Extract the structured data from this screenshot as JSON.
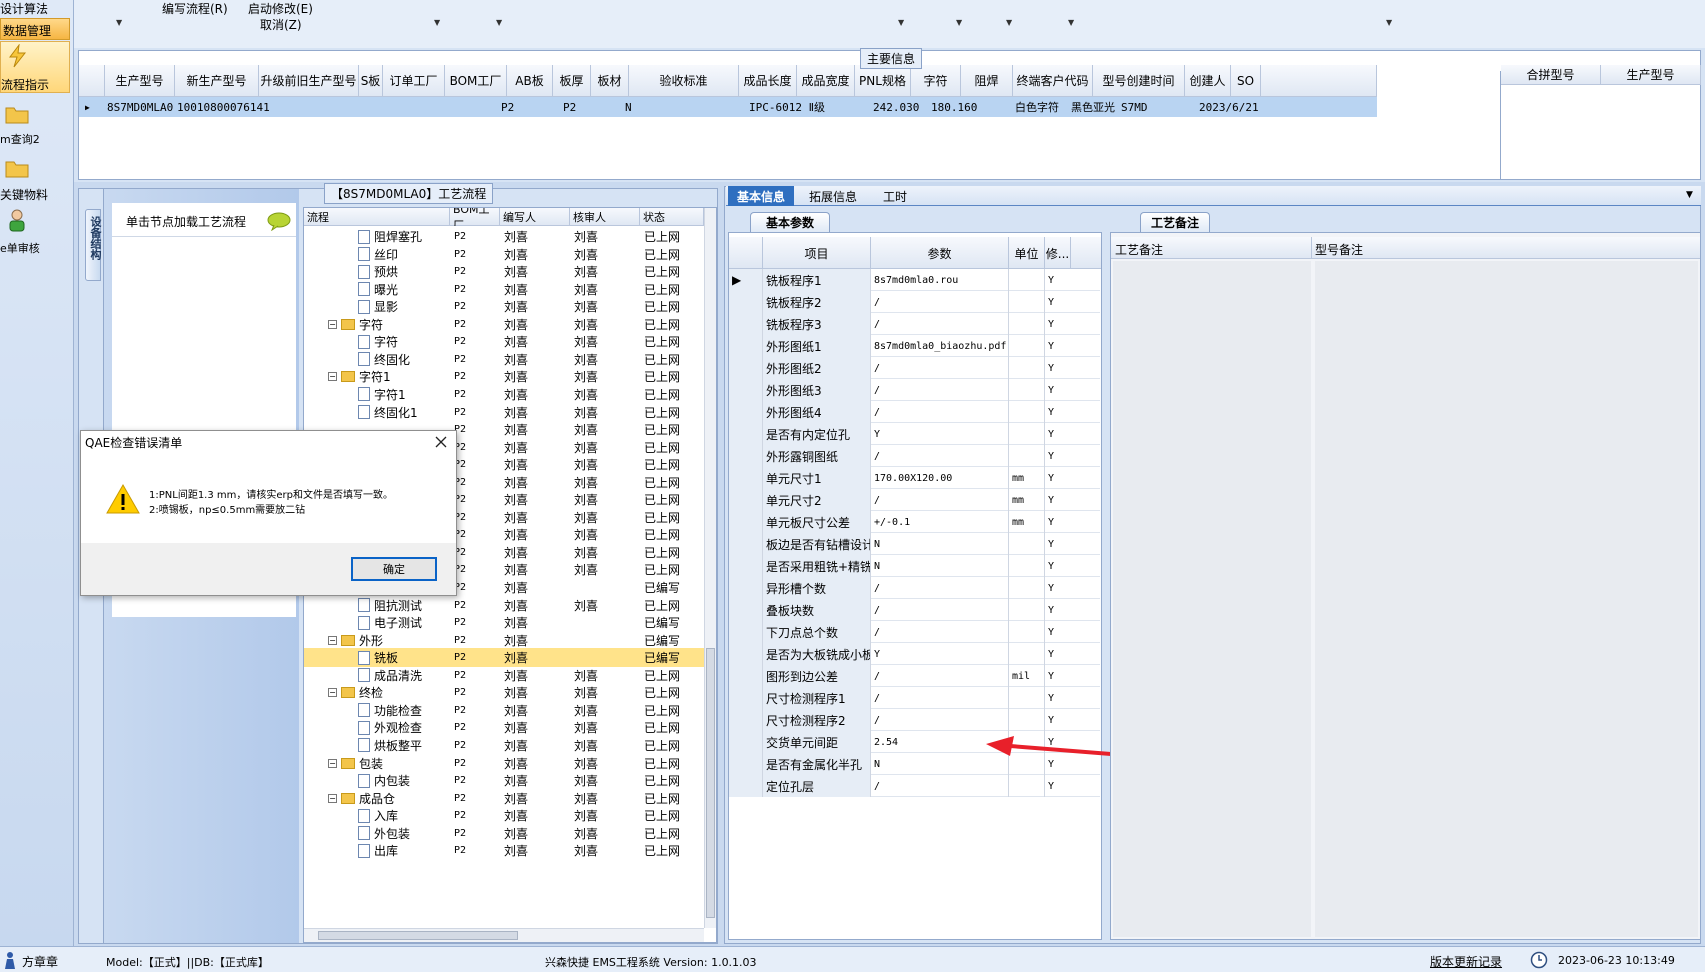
{
  "left_nav": {
    "design_algo": "设计算法",
    "data_mgmt": "数据管理",
    "flow_guide": "流程指示",
    "query2": "m查询2",
    "key_materials": "关键物料",
    "single_review": "e单审核"
  },
  "top_menu": {
    "edit_flow": "编写流程(R)",
    "start_modify": "启动修改(E)",
    "cancel": "取消(Z)"
  },
  "main_info": {
    "title": "主要信息",
    "columns": [
      "生产型号",
      "新生产型号",
      "升级前旧生产型号",
      "S板",
      "订单工厂",
      "BOM工厂",
      "AB板",
      "板厚",
      "板材",
      "验收标准",
      "成品长度",
      "成品宽度",
      "PNL规格",
      "字符",
      "阻焊",
      "终端客户代码",
      "型号创建时间",
      "创建人",
      "SO"
    ],
    "row": {
      "model": "8S7MD0MLA0",
      "new_model": "10010800076141",
      "order_factory": "P2",
      "bom_factory": "P2",
      "ab": "N",
      "standard": "IPC-6012 Ⅱ级",
      "length": "242.030",
      "width": "180.160",
      "char": "白色字符",
      "mask": "黑色亚光",
      "customer": "S7MD",
      "created": "2023/6/21"
    },
    "side_columns": [
      "合拼型号",
      "生产型号"
    ]
  },
  "flow_panel": {
    "title": "【8S7MD0MLA0】工艺流程",
    "vertical_tab": "设备结构",
    "load_hint": "单击节点加载工艺流程",
    "columns": [
      "流程",
      "BOM工厂",
      "编写人",
      "核审人",
      "状态"
    ],
    "rows": [
      {
        "name": "阻焊塞孔",
        "type": "file",
        "f": "P2",
        "w": "刘喜",
        "r": "刘喜",
        "s": "已上网"
      },
      {
        "name": "丝印",
        "type": "file",
        "f": "P2",
        "w": "刘喜",
        "r": "刘喜",
        "s": "已上网"
      },
      {
        "name": "预烘",
        "type": "file",
        "f": "P2",
        "w": "刘喜",
        "r": "刘喜",
        "s": "已上网"
      },
      {
        "name": "曝光",
        "type": "file",
        "f": "P2",
        "w": "刘喜",
        "r": "刘喜",
        "s": "已上网"
      },
      {
        "name": "显影",
        "type": "file",
        "f": "P2",
        "w": "刘喜",
        "r": "刘喜",
        "s": "已上网"
      },
      {
        "name": "字符",
        "type": "dir",
        "f": "P2",
        "w": "刘喜",
        "r": "刘喜",
        "s": "已上网"
      },
      {
        "name": "字符",
        "type": "file",
        "f": "P2",
        "w": "刘喜",
        "r": "刘喜",
        "s": "已上网"
      },
      {
        "name": "终固化",
        "type": "file",
        "f": "P2",
        "w": "刘喜",
        "r": "刘喜",
        "s": "已上网"
      },
      {
        "name": "字符1",
        "type": "dir",
        "f": "P2",
        "w": "刘喜",
        "r": "刘喜",
        "s": "已上网"
      },
      {
        "name": "字符1",
        "type": "file",
        "f": "P2",
        "w": "刘喜",
        "r": "刘喜",
        "s": "已上网"
      },
      {
        "name": "终固化1",
        "type": "file",
        "f": "P2",
        "w": "刘喜",
        "r": "刘喜",
        "s": "已上网"
      },
      {
        "name": "",
        "type": "none",
        "f": "P2",
        "w": "刘喜",
        "r": "刘喜",
        "s": "已上网"
      },
      {
        "name": "",
        "type": "none",
        "f": "P2",
        "w": "刘喜",
        "r": "刘喜",
        "s": "已上网"
      },
      {
        "name": "",
        "type": "none",
        "f": "P2",
        "w": "刘喜",
        "r": "刘喜",
        "s": "已上网"
      },
      {
        "name": "",
        "type": "none",
        "f": "P2",
        "w": "刘喜",
        "r": "刘喜",
        "s": "已上网"
      },
      {
        "name": "",
        "type": "none",
        "f": "P2",
        "w": "刘喜",
        "r": "刘喜",
        "s": "已上网"
      },
      {
        "name": "",
        "type": "none",
        "f": "P2",
        "w": "刘喜",
        "r": "刘喜",
        "s": "已上网"
      },
      {
        "name": "",
        "type": "none",
        "f": "P2",
        "w": "刘喜",
        "r": "刘喜",
        "s": "已上网"
      },
      {
        "name": "",
        "type": "none",
        "f": "P2",
        "w": "刘喜",
        "r": "刘喜",
        "s": "已上网"
      },
      {
        "name": "",
        "type": "none",
        "f": "P2",
        "w": "刘喜",
        "r": "刘喜",
        "s": "已上网"
      },
      {
        "name": "",
        "type": "none",
        "f": "P2",
        "w": "刘喜",
        "r": "",
        "s": "已编写"
      },
      {
        "name": "阻抗测试",
        "type": "file",
        "f": "P2",
        "w": "刘喜",
        "r": "刘喜",
        "s": "已上网"
      },
      {
        "name": "电子测试",
        "type": "file",
        "f": "P2",
        "w": "刘喜",
        "r": "",
        "s": "已编写"
      },
      {
        "name": "外形",
        "type": "dir",
        "f": "P2",
        "w": "刘喜",
        "r": "",
        "s": "已编写"
      },
      {
        "name": "铣板",
        "type": "file",
        "f": "P2",
        "w": "刘喜",
        "r": "",
        "s": "已编写",
        "sel": true
      },
      {
        "name": "成品清洗",
        "type": "file",
        "f": "P2",
        "w": "刘喜",
        "r": "刘喜",
        "s": "已上网"
      },
      {
        "name": "终检",
        "type": "dir",
        "f": "P2",
        "w": "刘喜",
        "r": "刘喜",
        "s": "已上网"
      },
      {
        "name": "功能检查",
        "type": "file",
        "f": "P2",
        "w": "刘喜",
        "r": "刘喜",
        "s": "已上网"
      },
      {
        "name": "外观检查",
        "type": "file",
        "f": "P2",
        "w": "刘喜",
        "r": "刘喜",
        "s": "已上网"
      },
      {
        "name": "烘板整平",
        "type": "file",
        "f": "P2",
        "w": "刘喜",
        "r": "刘喜",
        "s": "已上网"
      },
      {
        "name": "包装",
        "type": "dir",
        "f": "P2",
        "w": "刘喜",
        "r": "刘喜",
        "s": "已上网"
      },
      {
        "name": "内包装",
        "type": "file",
        "f": "P2",
        "w": "刘喜",
        "r": "刘喜",
        "s": "已上网"
      },
      {
        "name": "成品仓",
        "type": "dir",
        "f": "P2",
        "w": "刘喜",
        "r": "刘喜",
        "s": "已上网"
      },
      {
        "name": "入库",
        "type": "file",
        "f": "P2",
        "w": "刘喜",
        "r": "刘喜",
        "s": "已上网"
      },
      {
        "name": "外包装",
        "type": "file",
        "f": "P2",
        "w": "刘喜",
        "r": "刘喜",
        "s": "已上网"
      },
      {
        "name": "出库",
        "type": "file",
        "f": "P2",
        "w": "刘喜",
        "r": "刘喜",
        "s": "已上网"
      }
    ]
  },
  "right_tabs": [
    "基本信息",
    "拓展信息",
    "工时"
  ],
  "basic_params": {
    "subtab": "基本参数",
    "columns": [
      "项目",
      "参数",
      "单位",
      "修..."
    ],
    "rows": [
      {
        "item": "铣板程序1",
        "param": "8s7md0mla0.rou",
        "unit": "",
        "mod": "Y"
      },
      {
        "item": "铣板程序2",
        "param": "/",
        "unit": "",
        "mod": "Y"
      },
      {
        "item": "铣板程序3",
        "param": "/",
        "unit": "",
        "mod": "Y"
      },
      {
        "item": "外形图纸1",
        "param": "8s7md0mla0_biaozhu.pdf",
        "unit": "",
        "mod": "Y"
      },
      {
        "item": "外形图纸2",
        "param": "/",
        "unit": "",
        "mod": "Y"
      },
      {
        "item": "外形图纸3",
        "param": "/",
        "unit": "",
        "mod": "Y"
      },
      {
        "item": "外形图纸4",
        "param": "/",
        "unit": "",
        "mod": "Y"
      },
      {
        "item": "是否有内定位孔",
        "param": "Y",
        "unit": "",
        "mod": "Y"
      },
      {
        "item": "外形露铜图纸",
        "param": "/",
        "unit": "",
        "mod": "Y"
      },
      {
        "item": "单元尺寸1",
        "param": "170.00X120.00",
        "unit": "mm",
        "mod": "Y"
      },
      {
        "item": "单元尺寸2",
        "param": "/",
        "unit": "mm",
        "mod": "Y"
      },
      {
        "item": "单元板尺寸公差",
        "param": "+/-0.1",
        "unit": "mm",
        "mod": "Y"
      },
      {
        "item": "板边是否有钻槽设计",
        "param": "N",
        "unit": "",
        "mod": "Y"
      },
      {
        "item": "是否采用粗铣+精铣",
        "param": "N",
        "unit": "",
        "mod": "Y"
      },
      {
        "item": "异形槽个数",
        "param": "/",
        "unit": "",
        "mod": "Y"
      },
      {
        "item": "叠板块数",
        "param": "/",
        "unit": "",
        "mod": "Y"
      },
      {
        "item": "下刀点总个数",
        "param": "/",
        "unit": "",
        "mod": "Y"
      },
      {
        "item": "是否为大板铣成小板",
        "param": "Y",
        "unit": "",
        "mod": "Y"
      },
      {
        "item": "图形到边公差",
        "param": "/",
        "unit": "mil",
        "mod": "Y"
      },
      {
        "item": "尺寸检测程序1",
        "param": "/",
        "unit": "",
        "mod": "Y"
      },
      {
        "item": "尺寸检测程序2",
        "param": "/",
        "unit": "",
        "mod": "Y"
      },
      {
        "item": "交货单元间距",
        "param": "2.54",
        "unit": "",
        "mod": "Y"
      },
      {
        "item": "是否有金属化半孔",
        "param": "N",
        "unit": "",
        "mod": "Y"
      },
      {
        "item": "定位孔层",
        "param": "/",
        "unit": "",
        "mod": "Y"
      }
    ]
  },
  "remarks": {
    "tab": "工艺备注",
    "col1": "工艺备注",
    "col2": "型号备注"
  },
  "dialog": {
    "title": "QAE检查错误清单",
    "line1": "1:PNL间距1.3 mm，请核实erp和文件是否填写一致。",
    "line2": "2:喷锡板，np≤0.5mm需要放二钻",
    "ok": "确定"
  },
  "status_bar": {
    "user": "方章章",
    "model_db": "Model:【正式】||DB:【正式库】",
    "app": "兴森快捷 EMS工程系统 Version: 1.0.1.03",
    "update_log": "版本更新记录",
    "datetime": "2023-06-23 10:13:49"
  },
  "colors": {
    "accent": "#2f6fc0",
    "selection": "#b9d4f2",
    "highlight": "#ffe38a",
    "arrow": "#e8202a"
  }
}
